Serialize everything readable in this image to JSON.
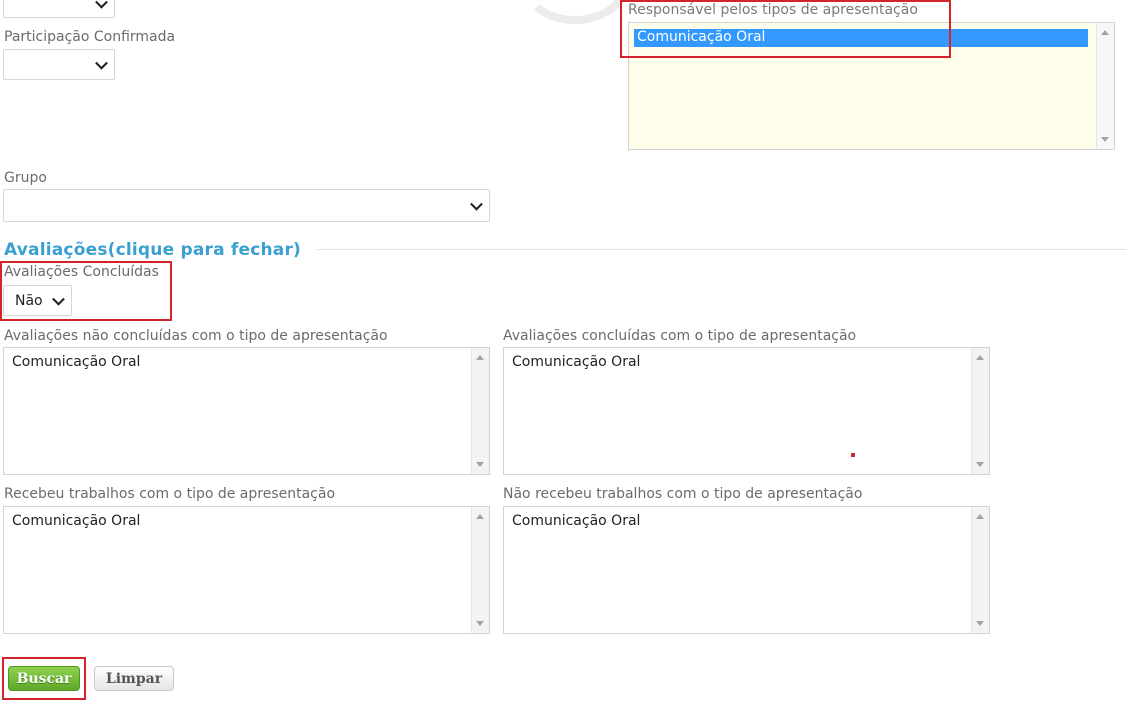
{
  "filters": {
    "participacao_label": "Participação Confirmada",
    "participacao_value": "",
    "grupo_label": "Grupo",
    "grupo_value": "",
    "responsavel_label": "Responsável pelos tipos de apresentação",
    "responsavel_option": "Comunicação Oral"
  },
  "avaliacoes": {
    "section_title": "Avaliações(clique para fechar)",
    "concluidas_label": "Avaliações Concluídas",
    "concluidas_value": "Não",
    "nao_concluidas_label": "Avaliações não concluídas com o tipo de apresentação",
    "nao_concluidas_option": "Comunicação Oral",
    "concluidas_tipo_label": "Avaliações concluídas com o tipo de apresentação",
    "concluidas_tipo_option": "Comunicação Oral",
    "recebeu_label": "Recebeu trabalhos com o tipo de apresentação",
    "recebeu_option": "Comunicação Oral",
    "nao_recebeu_label": "Não recebeu trabalhos com o tipo de apresentação",
    "nao_recebeu_option": "Comunicação Oral"
  },
  "actions": {
    "buscar_label": "Buscar",
    "limpar_label": "Limpar"
  },
  "colors": {
    "section_title": "#3a9fd1",
    "highlight_box": "#d2252b",
    "selected_option": "#3399ff",
    "buscar_button": "#66b032"
  }
}
